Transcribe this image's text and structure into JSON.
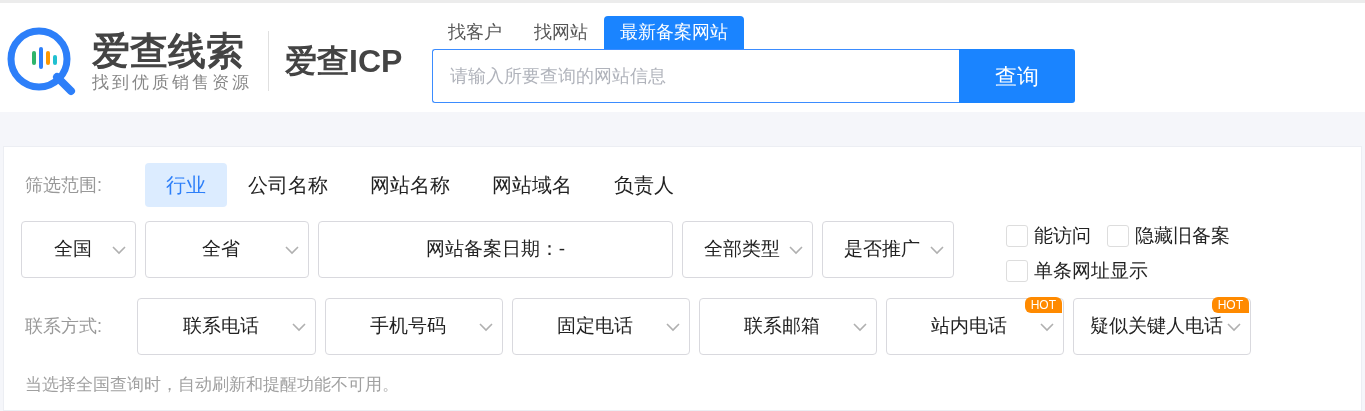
{
  "logo": {
    "name": "爱查线索",
    "slogan": "找到优质销售资源",
    "product": "爱查ICP"
  },
  "search_tabs": [
    {
      "label": "找客户",
      "selected": false
    },
    {
      "label": "找网站",
      "selected": false
    },
    {
      "label": "最新备案网站",
      "selected": true
    }
  ],
  "search": {
    "placeholder": "请输入所要查询的网站信息",
    "button": "查询"
  },
  "filter_scope": {
    "label": "筛选范围:",
    "tabs": [
      {
        "label": "行业",
        "selected": true
      },
      {
        "label": "公司名称",
        "selected": false
      },
      {
        "label": "网站名称",
        "selected": false
      },
      {
        "label": "网站域名",
        "selected": false
      },
      {
        "label": "负责人",
        "selected": false
      }
    ]
  },
  "filters": [
    {
      "kind": "select",
      "label": "全国"
    },
    {
      "kind": "select",
      "label": "全省"
    },
    {
      "kind": "date",
      "label": "网站备案日期：-"
    },
    {
      "kind": "select",
      "label": "全部类型"
    },
    {
      "kind": "select",
      "label": "是否推广"
    }
  ],
  "checkboxes": [
    {
      "label": "能访问",
      "checked": false
    },
    {
      "label": "隐藏旧备案",
      "checked": false
    },
    {
      "label": "单条网址显示",
      "checked": false
    }
  ],
  "contact": {
    "label": "联系方式:",
    "selects": [
      {
        "label": "联系电话"
      },
      {
        "label": "手机号码"
      },
      {
        "label": "固定电话"
      },
      {
        "label": "联系邮箱"
      },
      {
        "label": "站内电话",
        "badge": "HOT"
      },
      {
        "label": "疑似关键人电话",
        "badge": "HOT"
      }
    ]
  },
  "note": "当选择全国查询时，自动刷新和提醒功能不可用。"
}
